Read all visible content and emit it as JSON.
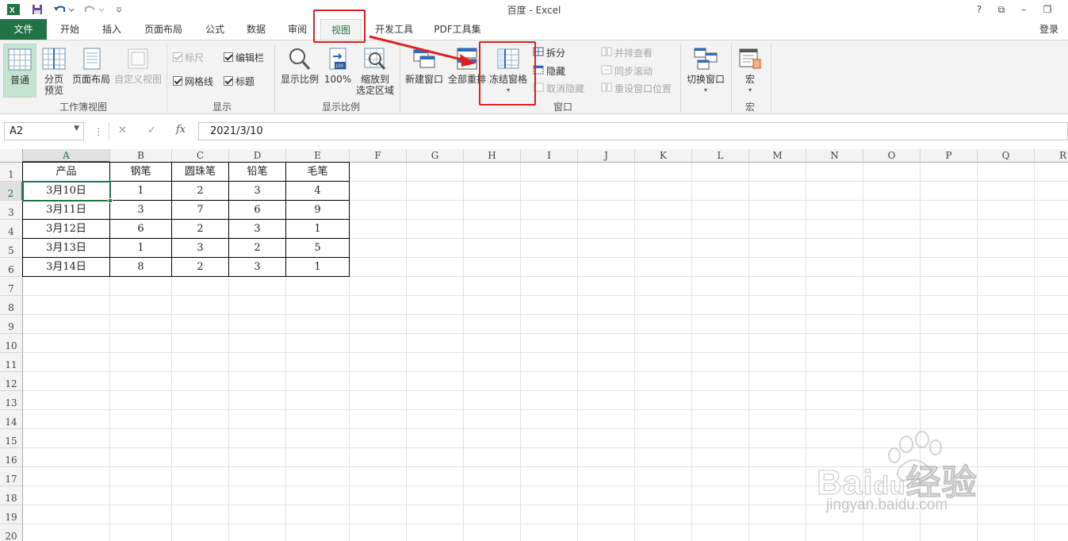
{
  "window": {
    "title": "百度 - Excel",
    "controls": [
      "?",
      "⧉",
      "–",
      "❐"
    ]
  },
  "quick_access": {
    "icons": [
      "excel-logo-icon",
      "save-icon",
      "undo-icon",
      "redo-icon",
      "customize-icon"
    ]
  },
  "tabs": {
    "file": "文件",
    "items": [
      "开始",
      "插入",
      "页面布局",
      "公式",
      "数据",
      "审阅",
      "视图",
      "开发工具",
      "PDF工具集"
    ],
    "active": "视图",
    "login": "登录"
  },
  "ribbon": {
    "workbook_views": {
      "label": "工作簿视图",
      "normal": "普通",
      "page_break_1": "分页",
      "page_break_2": "预览",
      "page_layout": "页面布局",
      "custom_views": "自定义视图"
    },
    "show": {
      "label": "显示",
      "ruler": "标尺",
      "formula_bar": "编辑栏",
      "gridlines": "网格线",
      "headings": "标题"
    },
    "zoom": {
      "label": "显示比例",
      "zoom": "显示比例",
      "hundred": "100%",
      "zoom_selection_1": "缩放到",
      "zoom_selection_2": "选定区域"
    },
    "window": {
      "label": "窗口",
      "new_window": "新建窗口",
      "arrange_all": "全部重排",
      "freeze_panes": "冻结窗格",
      "split": "拆分",
      "hide": "隐藏",
      "unhide": "取消隐藏",
      "side_by_side": "并排查看",
      "sync_scroll": "同步滚动",
      "reset_position": "重设窗口位置",
      "switch_windows": "切换窗口"
    },
    "macros": {
      "label": "宏",
      "macros": "宏"
    }
  },
  "formula_bar": {
    "name_box": "A2",
    "cancel": "✕",
    "enter": "✓",
    "fx": "fx",
    "content": "2021/3/10"
  },
  "sheet": {
    "columns": [
      "A",
      "B",
      "C",
      "D",
      "E",
      "F",
      "G",
      "H",
      "I",
      "J",
      "K",
      "L",
      "M",
      "N",
      "O",
      "P",
      "Q",
      "R"
    ],
    "rows": [
      "1",
      "2",
      "3",
      "4",
      "5",
      "6",
      "7",
      "8",
      "9",
      "10",
      "11",
      "12",
      "13",
      "14",
      "15",
      "16",
      "17",
      "18",
      "19",
      "20"
    ],
    "selected_cell": "A2",
    "table": [
      [
        "产品",
        "钢笔",
        "圆珠笔",
        "铅笔",
        "毛笔"
      ],
      [
        "3月10日",
        "1",
        "2",
        "3",
        "4"
      ],
      [
        "3月11日",
        "3",
        "7",
        "6",
        "9"
      ],
      [
        "3月12日",
        "6",
        "2",
        "3",
        "1"
      ],
      [
        "3月13日",
        "1",
        "3",
        "2",
        "5"
      ],
      [
        "3月14日",
        "8",
        "2",
        "3",
        "1"
      ]
    ]
  },
  "annotation_color": "#e02020",
  "accent_color": "#217346",
  "watermark": {
    "brand": "Bai",
    "brand2": "du",
    "suffix": "经验",
    "url": "jingyan.baidu.com"
  }
}
